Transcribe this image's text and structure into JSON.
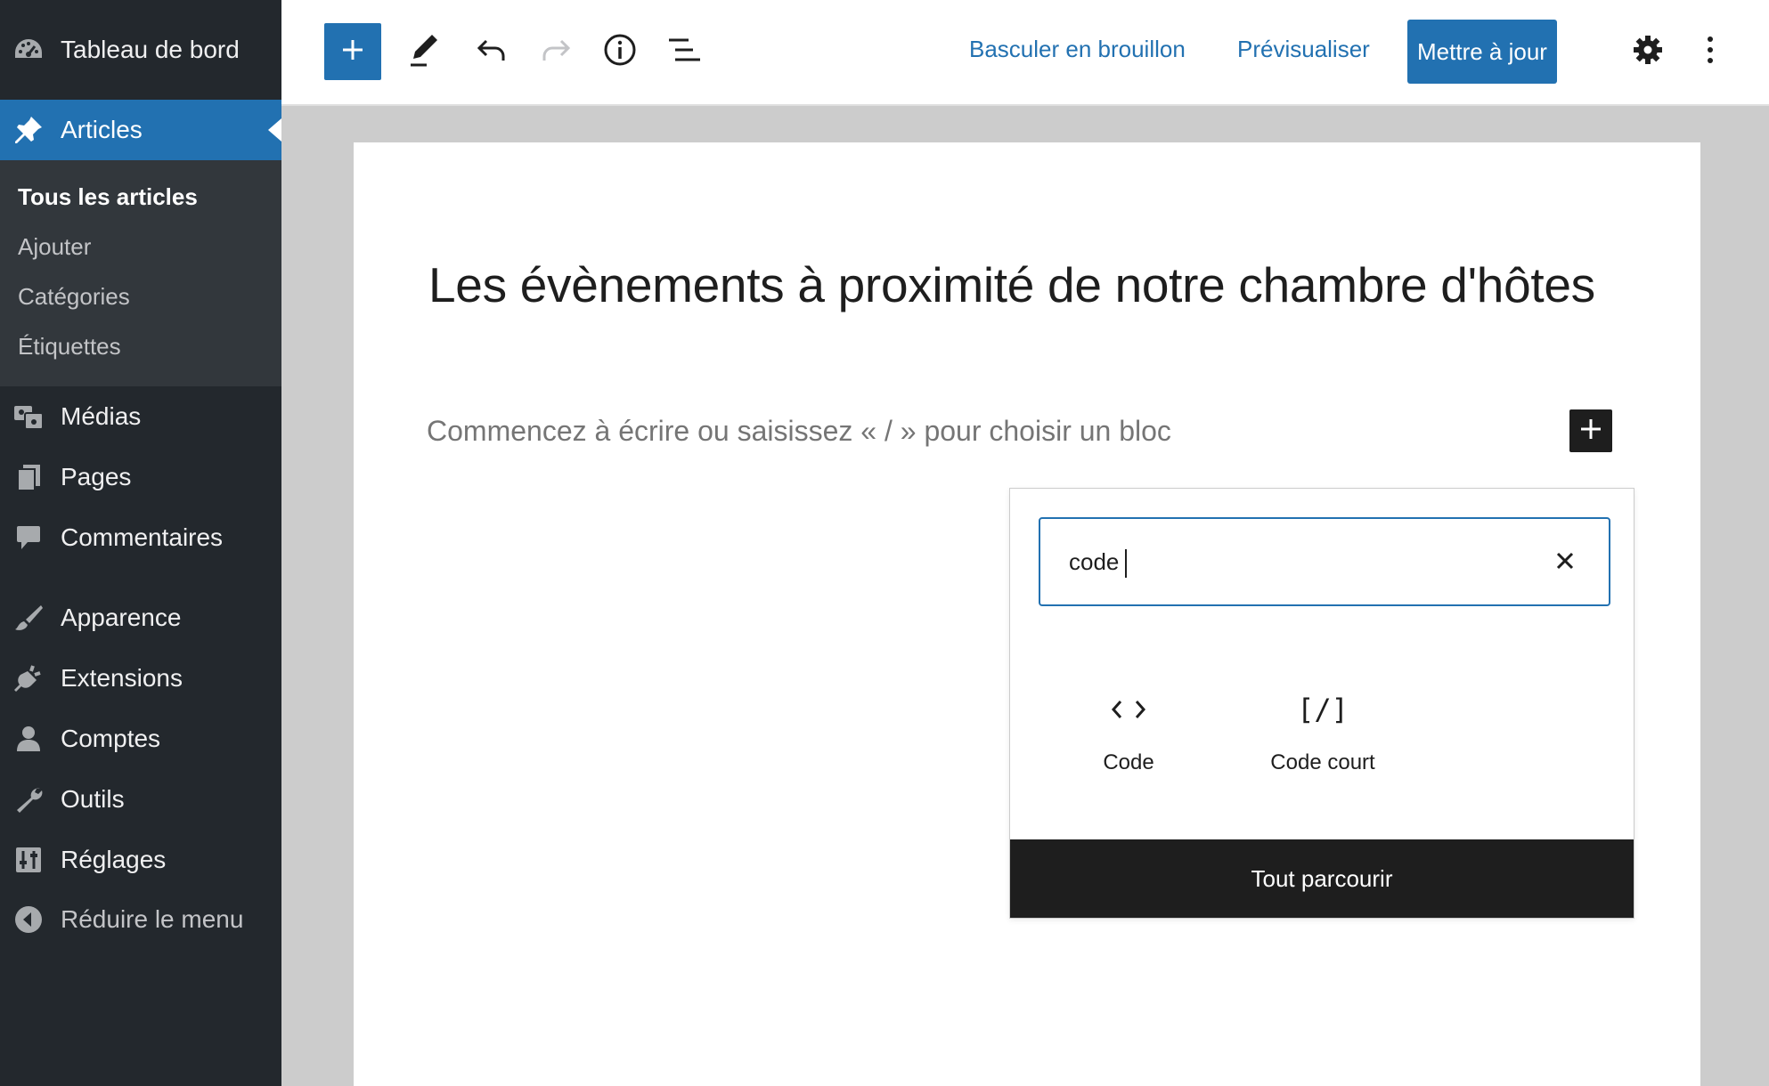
{
  "sidebar": {
    "dashboard": "Tableau de bord",
    "posts": "Articles",
    "submenu": {
      "all_posts": "Tous les articles",
      "add": "Ajouter",
      "categories": "Catégories",
      "tags": "Étiquettes"
    },
    "media": "Médias",
    "pages": "Pages",
    "comments": "Commentaires",
    "appearance": "Apparence",
    "plugins": "Extensions",
    "users": "Comptes",
    "tools": "Outils",
    "settings": "Réglages",
    "collapse": "Réduire le menu"
  },
  "toolbar": {
    "switch_to_draft": "Basculer en brouillon",
    "preview": "Prévisualiser",
    "update": "Mettre à jour",
    "accent": "#2271b1"
  },
  "editor": {
    "title": "Les évènements à proximité de notre chambre d'hôtes",
    "placeholder": "Commencez à écrire ou saisissez « / » pour choisir un bloc"
  },
  "inserter": {
    "search_value": "code",
    "results": [
      {
        "icon": "‹ ›",
        "label": "Code"
      },
      {
        "icon": "[/]",
        "label": "Code court"
      }
    ],
    "browse_all": "Tout parcourir"
  }
}
